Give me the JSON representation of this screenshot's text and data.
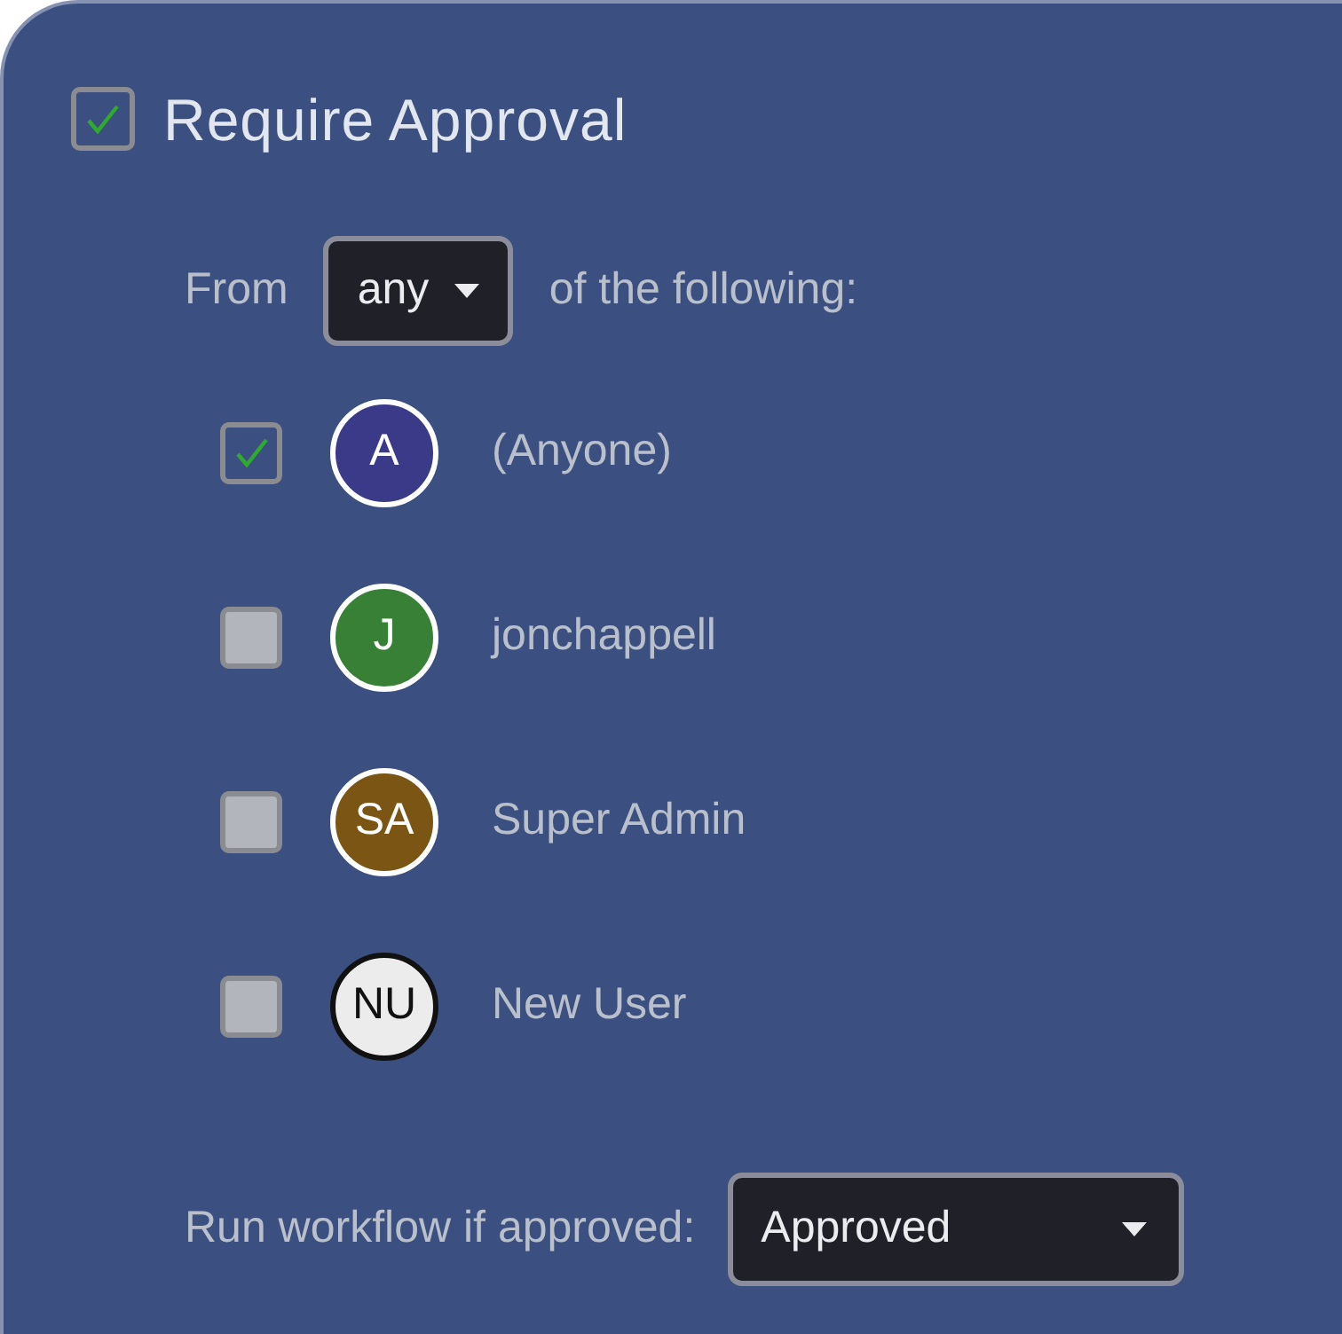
{
  "section": {
    "title": "Require Approval",
    "checked": true
  },
  "rule": {
    "prefix": "From",
    "quantifier": "any",
    "suffix": "of the following:"
  },
  "approvers": [
    {
      "initials": "A",
      "name": "(Anyone)",
      "checked": true,
      "color": "#3a3a88"
    },
    {
      "initials": "J",
      "name": "jonchappell",
      "checked": false,
      "color": "#378036"
    },
    {
      "initials": "SA",
      "name": "Super Admin",
      "checked": false,
      "color": "#7a5514"
    },
    {
      "initials": "NU",
      "name": "New User",
      "checked": false,
      "color": "#ececec"
    }
  ],
  "run_workflow": {
    "label": "Run workflow if approved:",
    "value": "Approved"
  }
}
